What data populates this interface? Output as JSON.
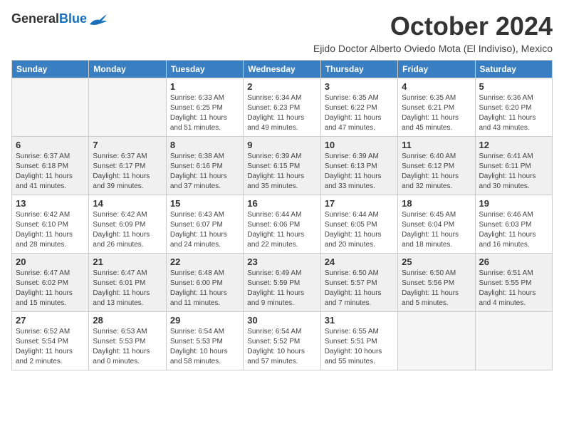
{
  "logo": {
    "line1": "General",
    "line2": "Blue",
    "bird_color": "#1a6fba"
  },
  "header": {
    "month": "October 2024",
    "location": "Ejido Doctor Alberto Oviedo Mota (El Indiviso), Mexico"
  },
  "weekdays": [
    "Sunday",
    "Monday",
    "Tuesday",
    "Wednesday",
    "Thursday",
    "Friday",
    "Saturday"
  ],
  "weeks": [
    {
      "shaded": false,
      "days": [
        {
          "num": "",
          "info": ""
        },
        {
          "num": "",
          "info": ""
        },
        {
          "num": "1",
          "info": "Sunrise: 6:33 AM\nSunset: 6:25 PM\nDaylight: 11 hours\nand 51 minutes."
        },
        {
          "num": "2",
          "info": "Sunrise: 6:34 AM\nSunset: 6:23 PM\nDaylight: 11 hours\nand 49 minutes."
        },
        {
          "num": "3",
          "info": "Sunrise: 6:35 AM\nSunset: 6:22 PM\nDaylight: 11 hours\nand 47 minutes."
        },
        {
          "num": "4",
          "info": "Sunrise: 6:35 AM\nSunset: 6:21 PM\nDaylight: 11 hours\nand 45 minutes."
        },
        {
          "num": "5",
          "info": "Sunrise: 6:36 AM\nSunset: 6:20 PM\nDaylight: 11 hours\nand 43 minutes."
        }
      ]
    },
    {
      "shaded": true,
      "days": [
        {
          "num": "6",
          "info": "Sunrise: 6:37 AM\nSunset: 6:18 PM\nDaylight: 11 hours\nand 41 minutes."
        },
        {
          "num": "7",
          "info": "Sunrise: 6:37 AM\nSunset: 6:17 PM\nDaylight: 11 hours\nand 39 minutes."
        },
        {
          "num": "8",
          "info": "Sunrise: 6:38 AM\nSunset: 6:16 PM\nDaylight: 11 hours\nand 37 minutes."
        },
        {
          "num": "9",
          "info": "Sunrise: 6:39 AM\nSunset: 6:15 PM\nDaylight: 11 hours\nand 35 minutes."
        },
        {
          "num": "10",
          "info": "Sunrise: 6:39 AM\nSunset: 6:13 PM\nDaylight: 11 hours\nand 33 minutes."
        },
        {
          "num": "11",
          "info": "Sunrise: 6:40 AM\nSunset: 6:12 PM\nDaylight: 11 hours\nand 32 minutes."
        },
        {
          "num": "12",
          "info": "Sunrise: 6:41 AM\nSunset: 6:11 PM\nDaylight: 11 hours\nand 30 minutes."
        }
      ]
    },
    {
      "shaded": false,
      "days": [
        {
          "num": "13",
          "info": "Sunrise: 6:42 AM\nSunset: 6:10 PM\nDaylight: 11 hours\nand 28 minutes."
        },
        {
          "num": "14",
          "info": "Sunrise: 6:42 AM\nSunset: 6:09 PM\nDaylight: 11 hours\nand 26 minutes."
        },
        {
          "num": "15",
          "info": "Sunrise: 6:43 AM\nSunset: 6:07 PM\nDaylight: 11 hours\nand 24 minutes."
        },
        {
          "num": "16",
          "info": "Sunrise: 6:44 AM\nSunset: 6:06 PM\nDaylight: 11 hours\nand 22 minutes."
        },
        {
          "num": "17",
          "info": "Sunrise: 6:44 AM\nSunset: 6:05 PM\nDaylight: 11 hours\nand 20 minutes."
        },
        {
          "num": "18",
          "info": "Sunrise: 6:45 AM\nSunset: 6:04 PM\nDaylight: 11 hours\nand 18 minutes."
        },
        {
          "num": "19",
          "info": "Sunrise: 6:46 AM\nSunset: 6:03 PM\nDaylight: 11 hours\nand 16 minutes."
        }
      ]
    },
    {
      "shaded": true,
      "days": [
        {
          "num": "20",
          "info": "Sunrise: 6:47 AM\nSunset: 6:02 PM\nDaylight: 11 hours\nand 15 minutes."
        },
        {
          "num": "21",
          "info": "Sunrise: 6:47 AM\nSunset: 6:01 PM\nDaylight: 11 hours\nand 13 minutes."
        },
        {
          "num": "22",
          "info": "Sunrise: 6:48 AM\nSunset: 6:00 PM\nDaylight: 11 hours\nand 11 minutes."
        },
        {
          "num": "23",
          "info": "Sunrise: 6:49 AM\nSunset: 5:59 PM\nDaylight: 11 hours\nand 9 minutes."
        },
        {
          "num": "24",
          "info": "Sunrise: 6:50 AM\nSunset: 5:57 PM\nDaylight: 11 hours\nand 7 minutes."
        },
        {
          "num": "25",
          "info": "Sunrise: 6:50 AM\nSunset: 5:56 PM\nDaylight: 11 hours\nand 5 minutes."
        },
        {
          "num": "26",
          "info": "Sunrise: 6:51 AM\nSunset: 5:55 PM\nDaylight: 11 hours\nand 4 minutes."
        }
      ]
    },
    {
      "shaded": false,
      "days": [
        {
          "num": "27",
          "info": "Sunrise: 6:52 AM\nSunset: 5:54 PM\nDaylight: 11 hours\nand 2 minutes."
        },
        {
          "num": "28",
          "info": "Sunrise: 6:53 AM\nSunset: 5:53 PM\nDaylight: 11 hours\nand 0 minutes."
        },
        {
          "num": "29",
          "info": "Sunrise: 6:54 AM\nSunset: 5:53 PM\nDaylight: 10 hours\nand 58 minutes."
        },
        {
          "num": "30",
          "info": "Sunrise: 6:54 AM\nSunset: 5:52 PM\nDaylight: 10 hours\nand 57 minutes."
        },
        {
          "num": "31",
          "info": "Sunrise: 6:55 AM\nSunset: 5:51 PM\nDaylight: 10 hours\nand 55 minutes."
        },
        {
          "num": "",
          "info": ""
        },
        {
          "num": "",
          "info": ""
        }
      ]
    }
  ]
}
